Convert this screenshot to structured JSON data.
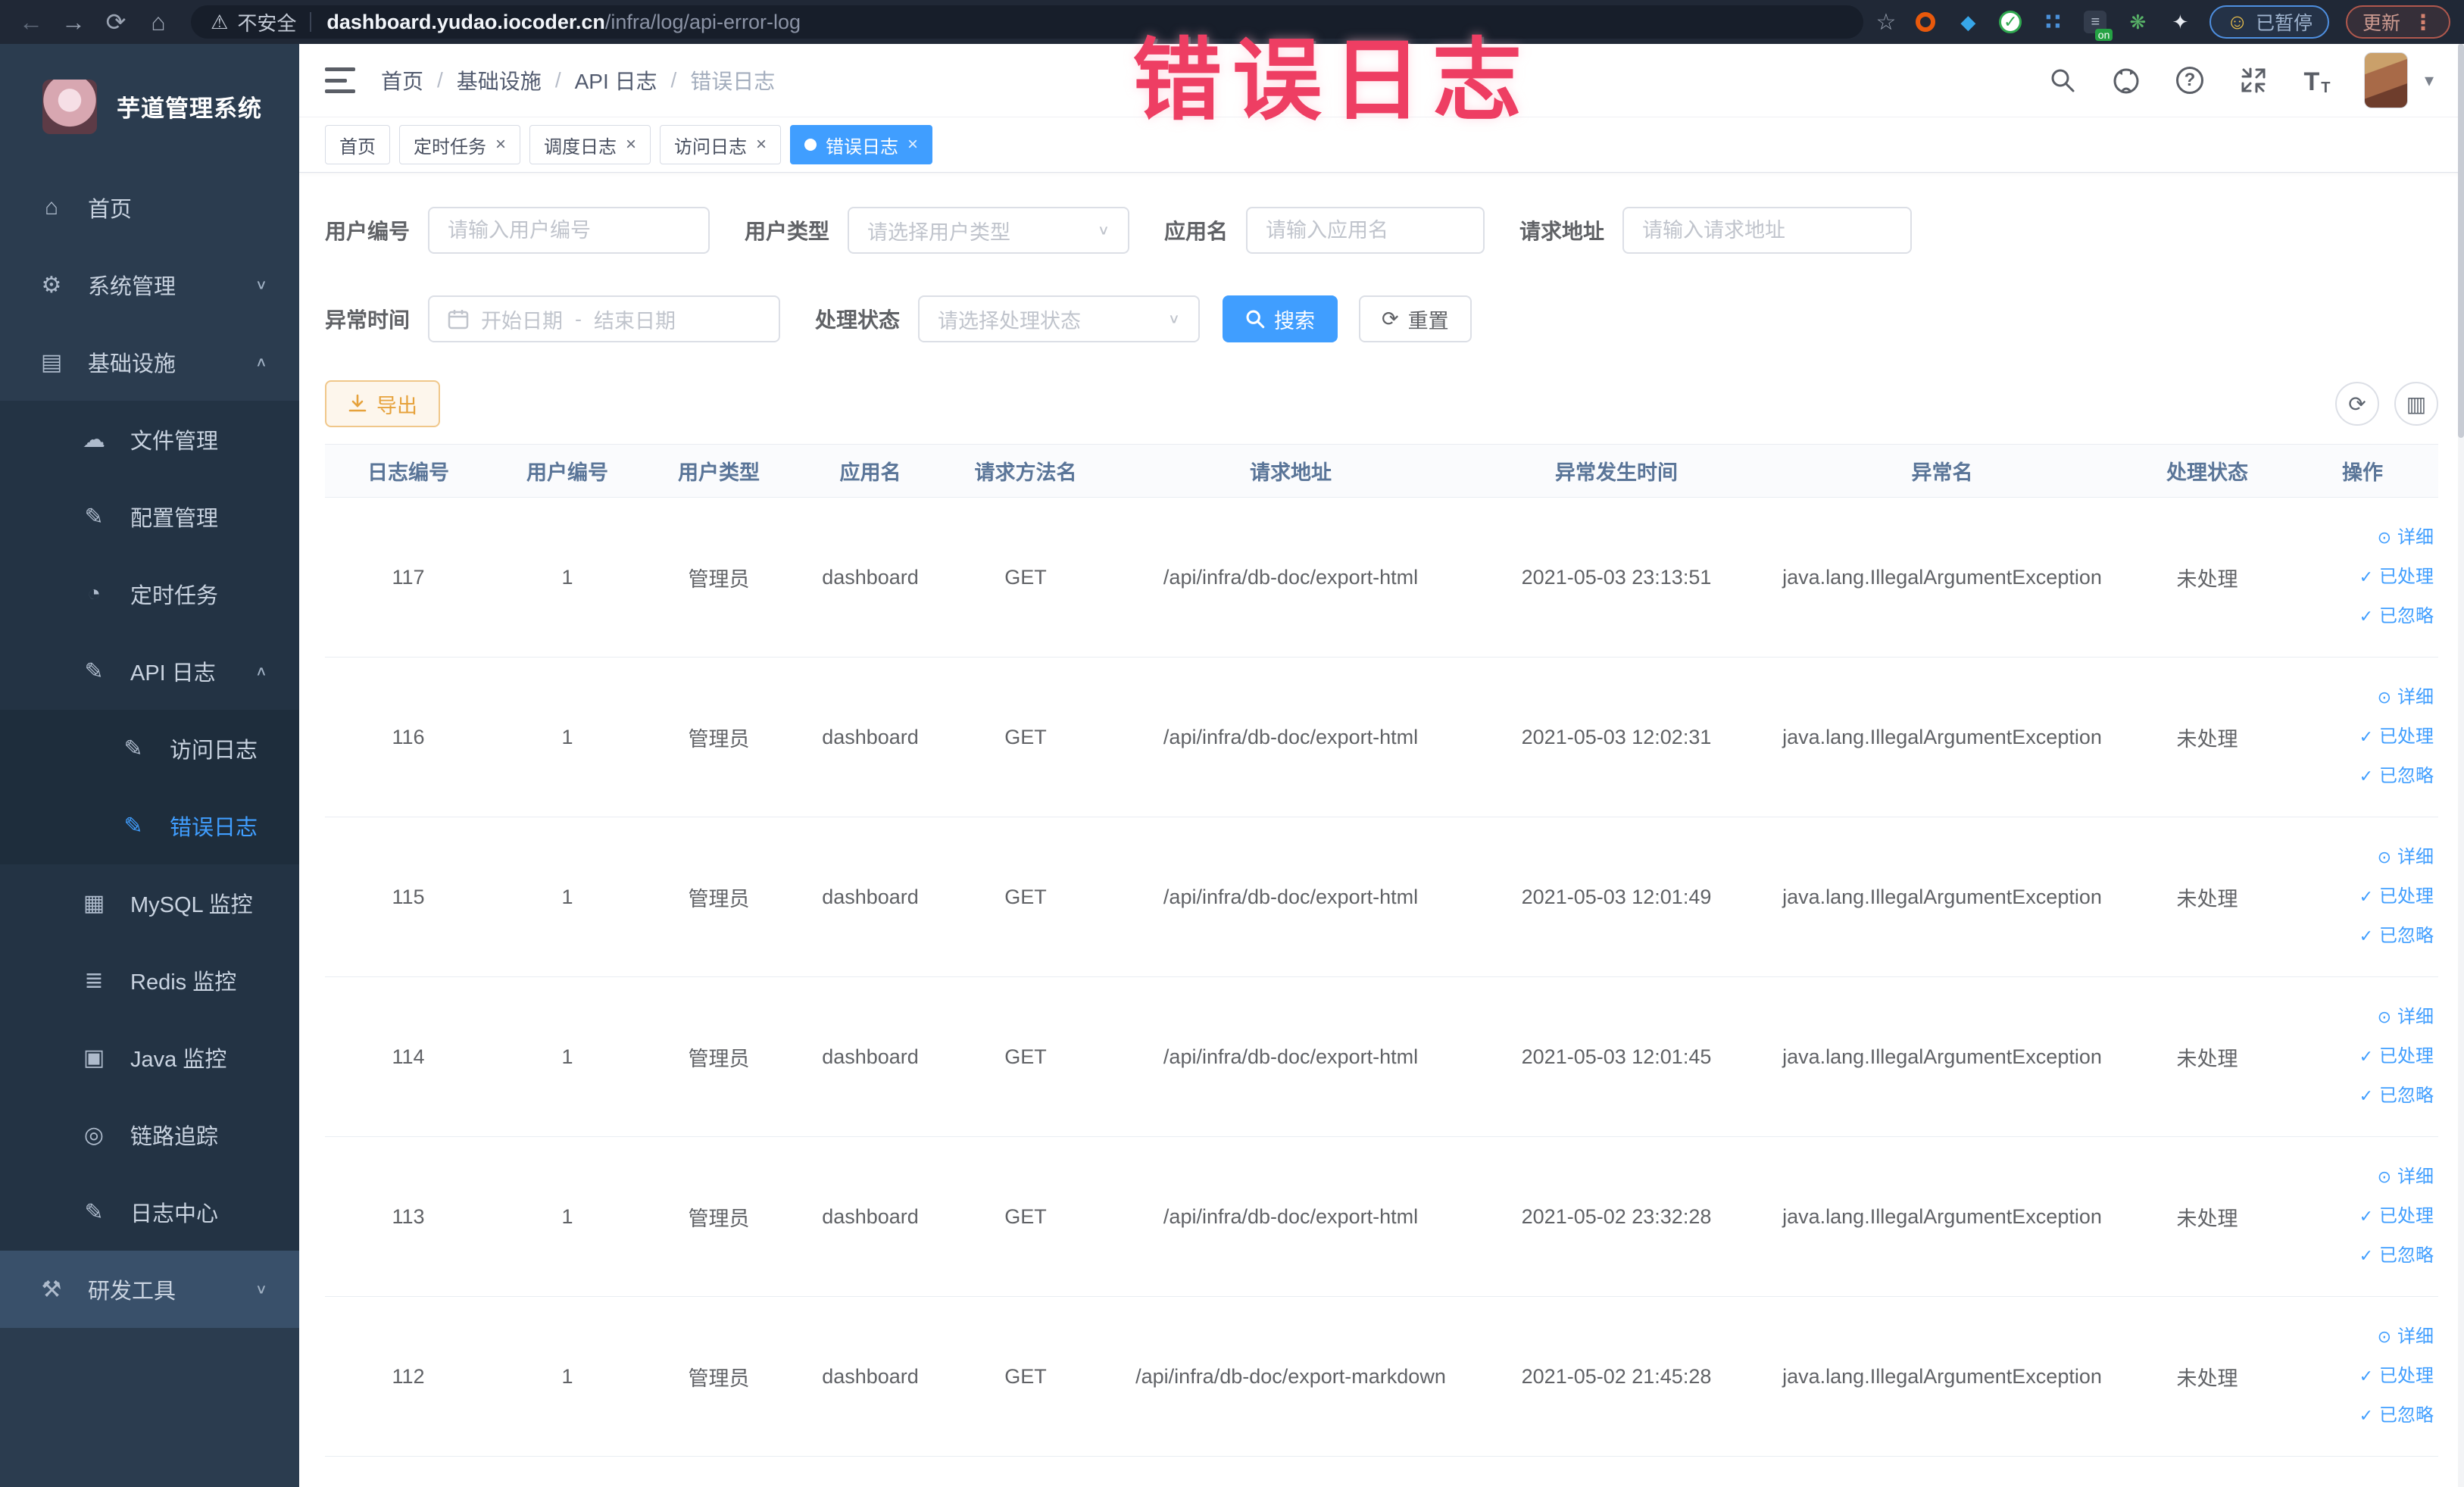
{
  "browser": {
    "security_label": "不安全",
    "url_host": "dashboard.yudao.iocoder.cn",
    "url_path": "/infra/log/api-error-log",
    "paused_badge": "已暂停",
    "update_badge": "更新"
  },
  "annotation": {
    "text": "错误日志"
  },
  "icons": {
    "back": "←",
    "forward": "→",
    "reload": "⟳",
    "home": "⌂",
    "warning": "⚠",
    "star": "☆",
    "menu_dots": "⋮",
    "smiley": "☺",
    "kite": "◆",
    "check": "✓",
    "dots_grid": "∷",
    "on_badge": "on",
    "leaf": "❋",
    "ghost": "✦",
    "breadcrumb_sep": "/",
    "caret_down": "▾",
    "select_caret": "∨",
    "help": "?",
    "chevron_down": "∨",
    "chevron_up": "∧",
    "font_big": "T",
    "font_small": "T",
    "columns": "▥",
    "refresh": "⟳",
    "eye": "⊙",
    "dark_lines": "≡",
    "tab_close": "×",
    "date_separator": "-"
  },
  "sidebar": {
    "title": "芋道管理系统",
    "items": [
      {
        "name": "home",
        "label": "首页",
        "glyph": "⌂",
        "icon": "home-icon",
        "level": 1,
        "chevron": "",
        "active": false,
        "cls": ""
      },
      {
        "name": "system-mgmt",
        "label": "系统管理",
        "glyph": "⚙",
        "icon": "gear-icon",
        "level": 1,
        "chevron": "∨",
        "active": false,
        "cls": ""
      },
      {
        "name": "infrastructure",
        "label": "基础设施",
        "glyph": "▤",
        "icon": "monitor-icon",
        "level": 1,
        "chevron": "∧",
        "active": false,
        "cls": ""
      },
      {
        "name": "file-mgmt",
        "label": "文件管理",
        "glyph": "☁",
        "icon": "cloud-upload-icon",
        "level": 2,
        "chevron": "",
        "active": false,
        "cls": ""
      },
      {
        "name": "config-mgmt",
        "label": "配置管理",
        "glyph": "✎",
        "icon": "edit-icon",
        "level": 2,
        "chevron": "",
        "active": false,
        "cls": ""
      },
      {
        "name": "scheduled-jobs",
        "label": "定时任务",
        "glyph": "◔",
        "icon": "clock-icon",
        "level": 2,
        "chevron": "",
        "active": false,
        "cls": ""
      },
      {
        "name": "api-log",
        "label": "API 日志",
        "glyph": "✎",
        "icon": "log-icon",
        "level": 2,
        "chevron": "∧",
        "active": false,
        "cls": ""
      },
      {
        "name": "access-log",
        "label": "访问日志",
        "glyph": "✎",
        "icon": "log-icon",
        "level": 3,
        "chevron": "",
        "active": false,
        "cls": ""
      },
      {
        "name": "error-log",
        "label": "错误日志",
        "glyph": "✎",
        "icon": "log-icon",
        "level": 3,
        "chevron": "",
        "active": true,
        "cls": ""
      },
      {
        "name": "mysql-monitor",
        "label": "MySQL 监控",
        "glyph": "▦",
        "icon": "chart-icon",
        "level": 2,
        "chevron": "",
        "active": false,
        "cls": ""
      },
      {
        "name": "redis-monitor",
        "label": "Redis 监控",
        "glyph": "≣",
        "icon": "stack-icon",
        "level": 2,
        "chevron": "",
        "active": false,
        "cls": ""
      },
      {
        "name": "java-monitor",
        "label": "Java 监控",
        "glyph": "▣",
        "icon": "screen-icon",
        "level": 2,
        "chevron": "",
        "active": false,
        "cls": ""
      },
      {
        "name": "tracing",
        "label": "链路追踪",
        "glyph": "◎",
        "icon": "eye-icon",
        "level": 2,
        "chevron": "",
        "active": false,
        "cls": ""
      },
      {
        "name": "log-center",
        "label": "日志中心",
        "glyph": "✎",
        "icon": "log-icon",
        "level": 2,
        "chevron": "",
        "active": false,
        "cls": ""
      },
      {
        "name": "dev-tools",
        "label": "研发工具",
        "glyph": "⚒",
        "icon": "toolbox-icon",
        "level": 1,
        "chevron": "∨",
        "active": false,
        "cls": "hovered"
      }
    ]
  },
  "breadcrumb": [
    "首页",
    "基础设施",
    "API 日志",
    "错误日志"
  ],
  "tabs": [
    {
      "label": "首页",
      "closable": false,
      "active": false
    },
    {
      "label": "定时任务",
      "closable": true,
      "active": false
    },
    {
      "label": "调度日志",
      "closable": true,
      "active": false
    },
    {
      "label": "访问日志",
      "closable": true,
      "active": false
    },
    {
      "label": "错误日志",
      "closable": true,
      "active": true
    }
  ],
  "filters": {
    "user_id": {
      "label": "用户编号",
      "placeholder": "请输入用户编号"
    },
    "user_type": {
      "label": "用户类型",
      "placeholder": "请选择用户类型"
    },
    "app_name": {
      "label": "应用名",
      "placeholder": "请输入应用名"
    },
    "request_url": {
      "label": "请求地址",
      "placeholder": "请输入请求地址"
    },
    "exception_time": {
      "label": "异常时间",
      "start_placeholder": "开始日期",
      "end_placeholder": "结束日期"
    },
    "process_status": {
      "label": "处理状态",
      "placeholder": "请选择处理状态"
    },
    "search_label": "搜索",
    "reset_label": "重置"
  },
  "toolbar": {
    "export_label": "导出"
  },
  "table": {
    "columns": [
      "日志编号",
      "用户编号",
      "用户类型",
      "应用名",
      "请求方法名",
      "请求地址",
      "异常发生时间",
      "异常名",
      "处理状态",
      "操作"
    ],
    "actions": [
      {
        "label": "详细",
        "glyph": "⊙",
        "icon": "eye-icon"
      },
      {
        "label": "已处理",
        "glyph": "✓",
        "icon": "check-icon"
      },
      {
        "label": "已忽略",
        "glyph": "✓",
        "icon": "check-icon"
      }
    ],
    "rows": [
      {
        "id": "117",
        "user_id": "1",
        "user_type": "管理员",
        "app_name": "dashboard",
        "method": "GET",
        "url": "/api/infra/db-doc/export-html",
        "time": "2021-05-03 23:13:51",
        "exception": "java.lang.IllegalArgumentException",
        "status": "未处理"
      },
      {
        "id": "116",
        "user_id": "1",
        "user_type": "管理员",
        "app_name": "dashboard",
        "method": "GET",
        "url": "/api/infra/db-doc/export-html",
        "time": "2021-05-03 12:02:31",
        "exception": "java.lang.IllegalArgumentException",
        "status": "未处理"
      },
      {
        "id": "115",
        "user_id": "1",
        "user_type": "管理员",
        "app_name": "dashboard",
        "method": "GET",
        "url": "/api/infra/db-doc/export-html",
        "time": "2021-05-03 12:01:49",
        "exception": "java.lang.IllegalArgumentException",
        "status": "未处理"
      },
      {
        "id": "114",
        "user_id": "1",
        "user_type": "管理员",
        "app_name": "dashboard",
        "method": "GET",
        "url": "/api/infra/db-doc/export-html",
        "time": "2021-05-03 12:01:45",
        "exception": "java.lang.IllegalArgumentException",
        "status": "未处理"
      },
      {
        "id": "113",
        "user_id": "1",
        "user_type": "管理员",
        "app_name": "dashboard",
        "method": "GET",
        "url": "/api/infra/db-doc/export-html",
        "time": "2021-05-02 23:32:28",
        "exception": "java.lang.IllegalArgumentException",
        "status": "未处理"
      },
      {
        "id": "112",
        "user_id": "1",
        "user_type": "管理员",
        "app_name": "dashboard",
        "method": "GET",
        "url": "/api/infra/db-doc/export-markdown",
        "time": "2021-05-02 21:45:28",
        "exception": "java.lang.IllegalArgumentException",
        "status": "未处理"
      }
    ]
  },
  "colors": {
    "accent": "#409eff",
    "warning": "#e6a23c",
    "annotation": "#ee3e63",
    "sidebar_bg": "#2b3c4f"
  }
}
